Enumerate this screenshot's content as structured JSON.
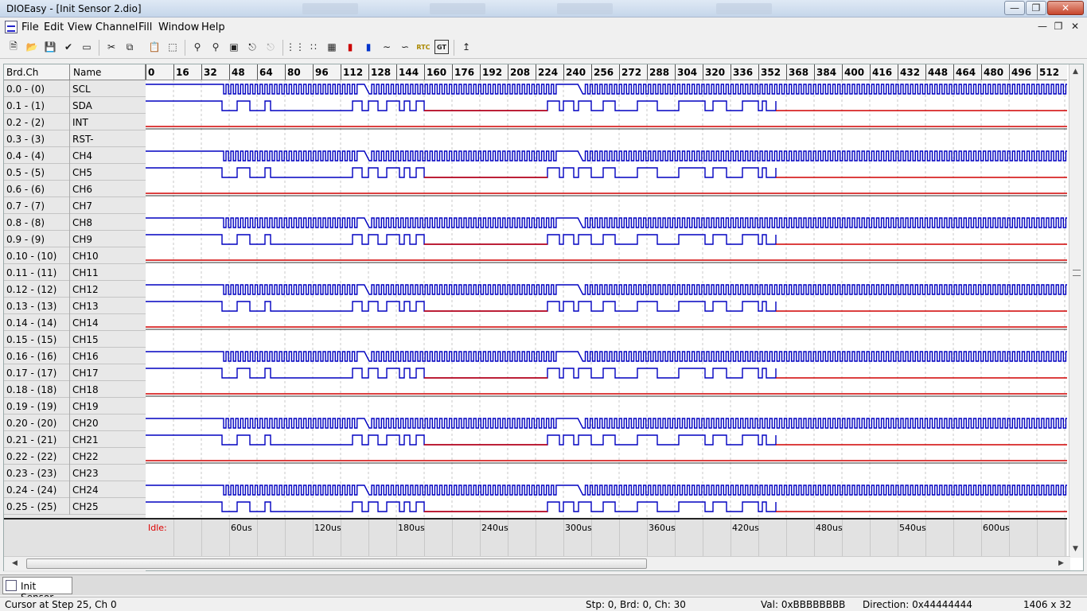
{
  "window": {
    "title": "DIOEasy - [Init Sensor 2.dio]"
  },
  "menu": [
    "File",
    "Edit",
    "View",
    "Channel",
    "Fill",
    "Window",
    "Help"
  ],
  "toolbar": {
    "icons": [
      "new-file-icon",
      "open-file-icon",
      "save-icon",
      "properties-icon",
      "select-rect-icon",
      "cut-icon",
      "copy-icon",
      "paste-icon",
      "select-all-icon",
      "zoom-icon",
      "zoom-in-icon",
      "zoom-fit-icon",
      "clock-wave-icon",
      "clock-wave-disabled-icon",
      "fill-high-icon",
      "fill-pattern-icon",
      "grid-icon",
      "insert-marker-red-icon",
      "insert-marker-blue-icon",
      "line-high-icon",
      "line-toggle-icon",
      "rtc-icon",
      "gt-icon",
      "help-cursor-icon"
    ],
    "rtc_label": "RTC",
    "gt_label": "GT"
  },
  "grid": {
    "header_brdch": "Brd.Ch",
    "header_name": "Name",
    "steps": [
      "0",
      "16",
      "32",
      "48",
      "64",
      "80",
      "96",
      "112",
      "128",
      "144",
      "160",
      "176",
      "192",
      "208",
      "224",
      "240",
      "256",
      "272",
      "288",
      "304",
      "320",
      "336",
      "352",
      "368",
      "384",
      "400",
      "416",
      "432",
      "448",
      "464",
      "480",
      "496",
      "512"
    ],
    "rows": [
      {
        "brdch": "0.0 - (0)",
        "name": "SCL",
        "sig": "scl"
      },
      {
        "brdch": "0.1 - (1)",
        "name": "SDA",
        "sig": "sda"
      },
      {
        "brdch": "0.2 - (2)",
        "name": "INT",
        "sig": "low"
      },
      {
        "brdch": "0.3 - (3)",
        "name": "RST-",
        "sig": "high"
      },
      {
        "brdch": "0.4 - (4)",
        "name": "CH4",
        "sig": "scl"
      },
      {
        "brdch": "0.5 - (5)",
        "name": "CH5",
        "sig": "sda"
      },
      {
        "brdch": "0.6 - (6)",
        "name": "CH6",
        "sig": "low"
      },
      {
        "brdch": "0.7 - (7)",
        "name": "CH7",
        "sig": "high"
      },
      {
        "brdch": "0.8 - (8)",
        "name": "CH8",
        "sig": "scl"
      },
      {
        "brdch": "0.9 - (9)",
        "name": "CH9",
        "sig": "sda"
      },
      {
        "brdch": "0.10 - (10)",
        "name": "CH10",
        "sig": "low"
      },
      {
        "brdch": "0.11 - (11)",
        "name": "CH11",
        "sig": "high"
      },
      {
        "brdch": "0.12 - (12)",
        "name": "CH12",
        "sig": "scl"
      },
      {
        "brdch": "0.13 - (13)",
        "name": "CH13",
        "sig": "sda"
      },
      {
        "brdch": "0.14 - (14)",
        "name": "CH14",
        "sig": "low"
      },
      {
        "brdch": "0.15 - (15)",
        "name": "CH15",
        "sig": "high"
      },
      {
        "brdch": "0.16 - (16)",
        "name": "CH16",
        "sig": "scl"
      },
      {
        "brdch": "0.17 - (17)",
        "name": "CH17",
        "sig": "sda"
      },
      {
        "brdch": "0.18 - (18)",
        "name": "CH18",
        "sig": "low"
      },
      {
        "brdch": "0.19 - (19)",
        "name": "CH19",
        "sig": "high"
      },
      {
        "brdch": "0.20 - (20)",
        "name": "CH20",
        "sig": "scl"
      },
      {
        "brdch": "0.21 - (21)",
        "name": "CH21",
        "sig": "sda"
      },
      {
        "brdch": "0.22 - (22)",
        "name": "CH22",
        "sig": "low"
      },
      {
        "brdch": "0.23 - (23)",
        "name": "CH23",
        "sig": "high"
      },
      {
        "brdch": "0.24 - (24)",
        "name": "CH24",
        "sig": "scl"
      },
      {
        "brdch": "0.25 - (25)",
        "name": "CH25",
        "sig": "sda"
      }
    ],
    "colors": {
      "signal": "#0000c0",
      "idle_low": "#d00000",
      "grid_line": "#c8c8c8"
    }
  },
  "timeline": {
    "idle_label": "Idle:",
    "labels": [
      "60us",
      "120us",
      "180us",
      "240us",
      "300us",
      "360us",
      "420us",
      "480us",
      "540us",
      "600us"
    ]
  },
  "tab": {
    "label": "Init Sensor ..."
  },
  "status": {
    "cursor": "Cursor at Step 25, Ch 0",
    "stp": "Stp: 0, Brd: 0, Ch: 30",
    "val": "Val: 0xBBBBBBBB",
    "direction": "Direction: 0x44444444",
    "size": "1406 x 32"
  }
}
